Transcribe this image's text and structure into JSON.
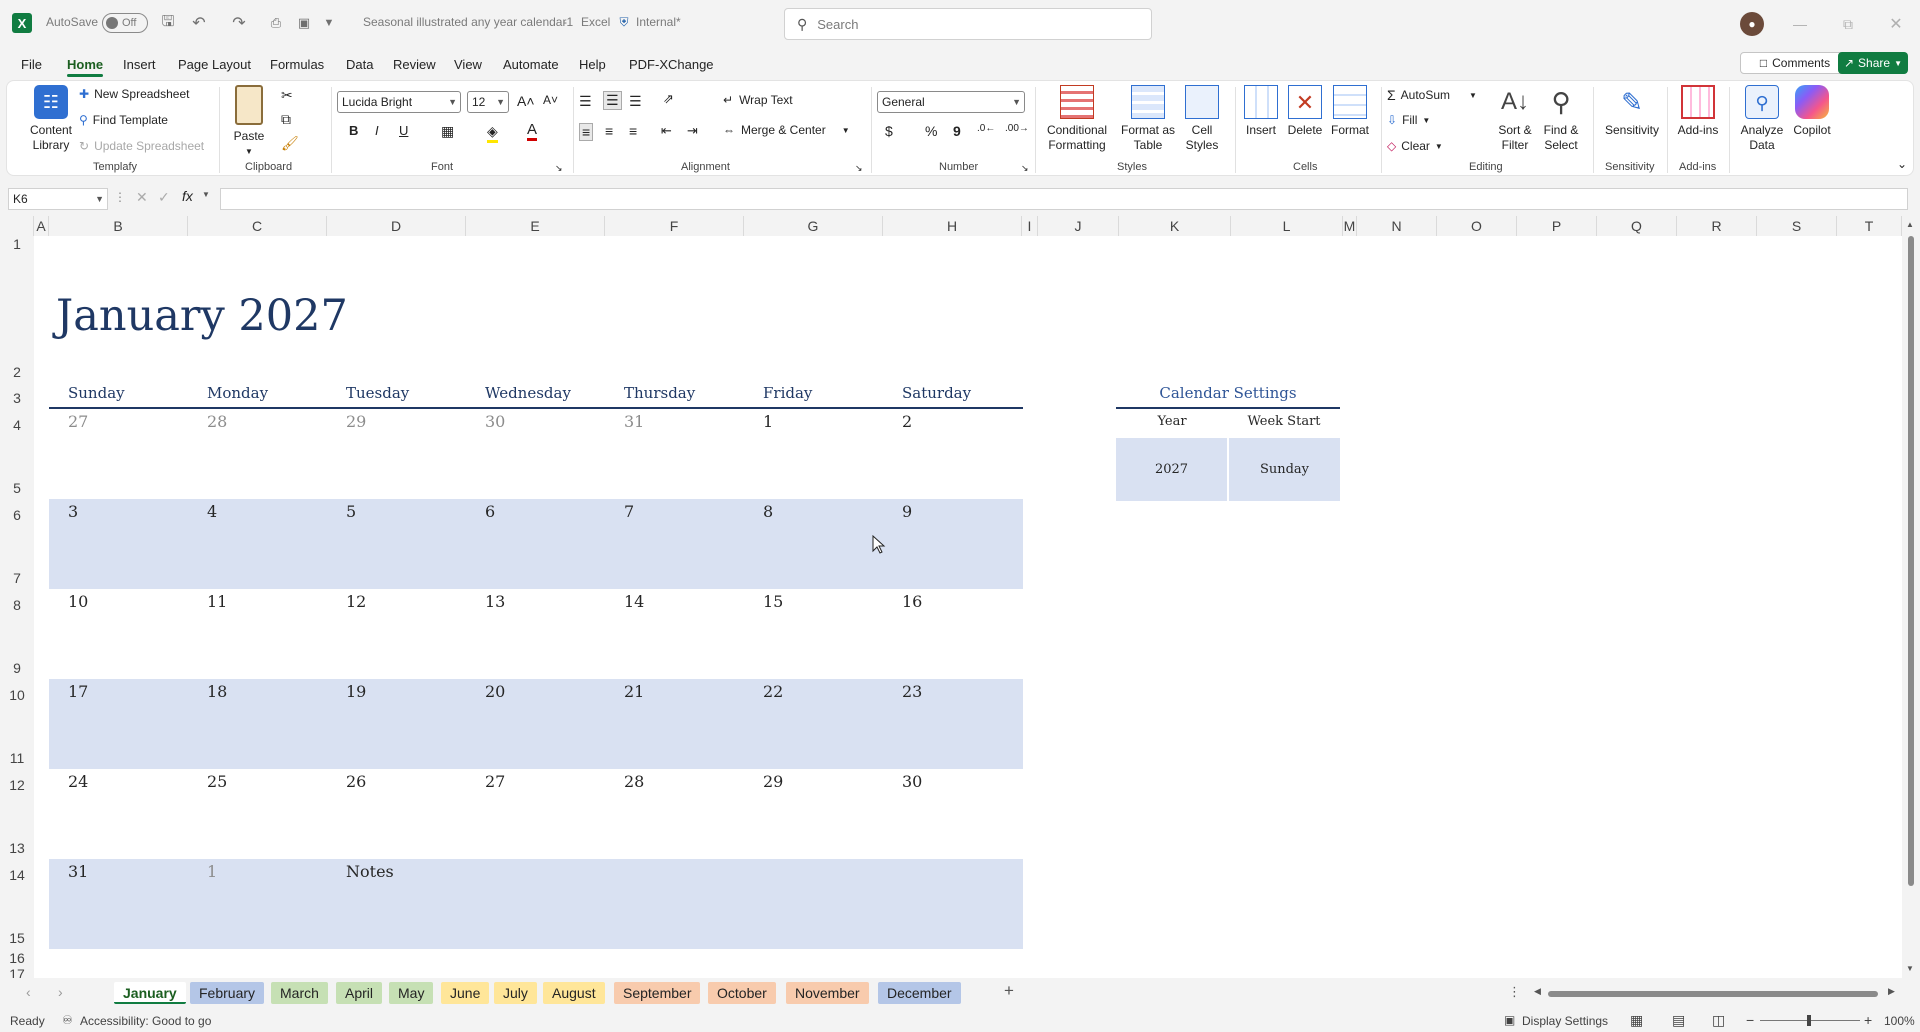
{
  "titlebar": {
    "autosave_label": "AutoSave",
    "autosave_state": "Off",
    "doc_title": "Seasonal illustrated any year calendar1",
    "app_name": "Excel",
    "sensitivity": "Internal*",
    "search_placeholder": "Search"
  },
  "menu": {
    "items": [
      "File",
      "Home",
      "Insert",
      "Page Layout",
      "Formulas",
      "Data",
      "Review",
      "View",
      "Automate",
      "Help",
      "PDF-XChange"
    ],
    "active": "Home",
    "comments_label": "Comments",
    "share_label": "Share"
  },
  "ribbon": {
    "templafy": {
      "content_library": "Content",
      "content_library2": "Library",
      "new_spreadsheet": "New Spreadsheet",
      "find_template": "Find Template",
      "update_spreadsheet": "Update Spreadsheet",
      "label": "Templafy"
    },
    "clipboard": {
      "paste": "Paste",
      "label": "Clipboard"
    },
    "font": {
      "name": "Lucida Bright",
      "size": "12",
      "bold": "B",
      "italic": "I",
      "underline": "U",
      "label": "Font"
    },
    "alignment": {
      "wrap_text": "Wrap Text",
      "merge_center": "Merge & Center",
      "label": "Alignment"
    },
    "number": {
      "format": "General",
      "currency": "$",
      "percent": "%",
      "comma": "9",
      "label": "Number"
    },
    "styles": {
      "conditional1": "Conditional",
      "conditional2": "Formatting",
      "format_table1": "Format as",
      "format_table2": "Table",
      "cell_styles1": "Cell",
      "cell_styles2": "Styles",
      "label": "Styles"
    },
    "cells": {
      "insert": "Insert",
      "delete": "Delete",
      "format": "Format",
      "label": "Cells"
    },
    "editing": {
      "autosum": "AutoSum",
      "fill": "Fill",
      "clear": "Clear",
      "sort1": "Sort &",
      "sort2": "Filter",
      "find1": "Find &",
      "find2": "Select",
      "label": "Editing"
    },
    "sensitivity": {
      "button": "Sensitivity",
      "label": "Sensitivity"
    },
    "addins": {
      "button": "Add-ins",
      "label": "Add-ins"
    },
    "analyze": {
      "line1": "Analyze",
      "line2": "Data"
    },
    "copilot": {
      "button": "Copilot"
    }
  },
  "formula_bar": {
    "name_box": "K6",
    "fx": "fx",
    "value": ""
  },
  "columns": [
    "A",
    "B",
    "C",
    "D",
    "E",
    "F",
    "G",
    "H",
    "I",
    "J",
    "K",
    "L",
    "M",
    "N",
    "O",
    "P",
    "Q",
    "R",
    "S",
    "T"
  ],
  "rows": [
    "1",
    "2",
    "3",
    "4",
    "5",
    "6",
    "7",
    "8",
    "9",
    "10",
    "11",
    "12",
    "13",
    "14",
    "15",
    "16",
    "17"
  ],
  "calendar": {
    "title": "January 2027",
    "weekdays": [
      "Sunday",
      "Monday",
      "Tuesday",
      "Wednesday",
      "Thursday",
      "Friday",
      "Saturday"
    ],
    "weeks": [
      [
        "27",
        "28",
        "29",
        "30",
        "31",
        "1",
        "2"
      ],
      [
        "3",
        "4",
        "5",
        "6",
        "7",
        "8",
        "9"
      ],
      [
        "10",
        "11",
        "12",
        "13",
        "14",
        "15",
        "16"
      ],
      [
        "17",
        "18",
        "19",
        "20",
        "21",
        "22",
        "23"
      ],
      [
        "24",
        "25",
        "26",
        "27",
        "28",
        "29",
        "30"
      ],
      [
        "31",
        "1",
        "Notes",
        "",
        "",
        "",
        ""
      ]
    ],
    "settings": {
      "title": "Calendar Settings",
      "year_label": "Year",
      "week_start_label": "Week Start",
      "year_value": "2027",
      "week_start_value": "Sunday"
    }
  },
  "sheet_tabs": [
    "January",
    "February",
    "March",
    "April",
    "May",
    "June",
    "July",
    "August",
    "September",
    "October",
    "November",
    "December"
  ],
  "tab_colors": [
    "#ffffff",
    "#b4c6e7",
    "#c6e0b4",
    "#c6e0b4",
    "#c6e0b4",
    "#ffe699",
    "#ffe699",
    "#ffe699",
    "#f8cbad",
    "#f8cbad",
    "#f8cbad",
    "#b4c6e7"
  ],
  "status": {
    "ready": "Ready",
    "accessibility": "Accessibility: Good to go",
    "display_settings": "Display Settings",
    "zoom": "100%"
  },
  "colors": {
    "excel_green": "#107c41",
    "title_navy": "#1f3864",
    "band_blue": "#d9e1f2"
  }
}
